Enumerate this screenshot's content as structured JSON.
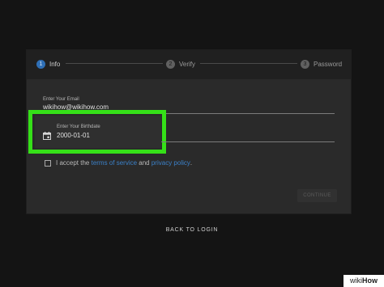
{
  "stepper": {
    "steps": [
      {
        "number": "1",
        "label": "Info"
      },
      {
        "number": "2",
        "label": "Verify"
      },
      {
        "number": "3",
        "label": "Password"
      }
    ]
  },
  "form": {
    "email": {
      "label": "Enter Your Email",
      "value": "wikihow@wikihow.com"
    },
    "birthdate": {
      "label": "Enter Your Birthdate",
      "value": "2000-01-01",
      "icon": "calendar-icon"
    },
    "terms": {
      "prefix": "I accept the ",
      "terms_link": "terms of service",
      "middle": " and ",
      "privacy_link": "privacy policy",
      "suffix": "."
    },
    "continue_label": "CONTINUE"
  },
  "back_to_login": "BACK TO LOGIN",
  "watermark": {
    "wiki": "wiki",
    "how": "How"
  },
  "colors": {
    "accent": "#2f6fb6",
    "link": "#3b80c8",
    "highlight": "#35e018"
  }
}
